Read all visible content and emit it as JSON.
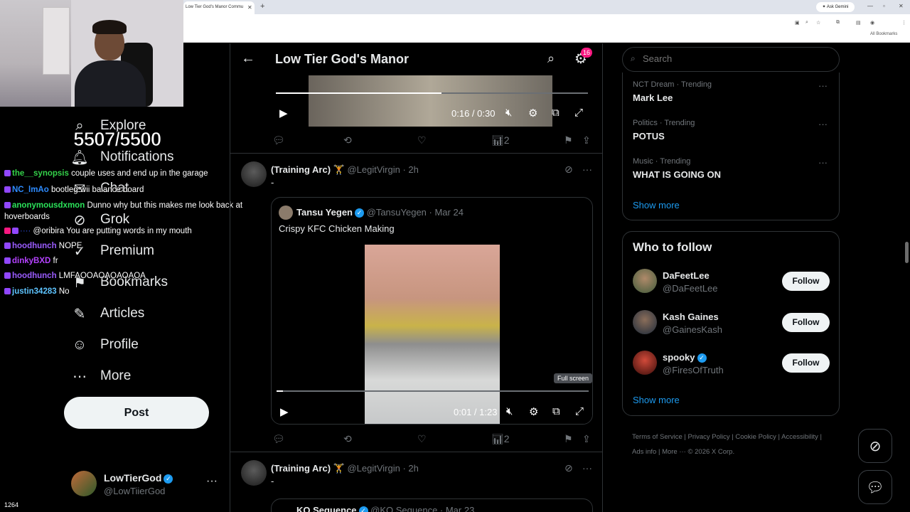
{
  "browser": {
    "tab_title": "Low Tier God's Manor Commu",
    "tab_close": "✕",
    "new_tab": "+",
    "ask_gemini": "✦ Ask Gemini",
    "bookmarks": "All Bookmarks"
  },
  "stream": {
    "sub_counter": "5507/5500",
    "viewer_count": "1264",
    "chat": [
      {
        "user": "the__synopsis",
        "color": "#34d24a",
        "msg": "couple uses and end up in the garage"
      },
      {
        "user": "NC_lmAo",
        "color": "#2e8cff",
        "msg": "bootleg wii balance board"
      },
      {
        "user": "anonymousdxmon",
        "color": "#2be35a",
        "msg": "Dunno why but this makes me look back at"
      },
      {
        "user": "",
        "color": "#fff",
        "msg": "hoverboards"
      },
      {
        "user": "",
        "color": "#2b4bd9",
        "msg": "@oribira You are putting words in my mouth"
      },
      {
        "user": "hoodhunch",
        "color": "#9b5cff",
        "msg": "NOPE"
      },
      {
        "user": "dinkyBXD",
        "color": "#b542ff",
        "msg": "fr"
      },
      {
        "user": "hoodhunch",
        "color": "#9b5cff",
        "msg": "LMFAOOAOAOAOAOA"
      },
      {
        "user": "justin34283",
        "color": "#5ec4ff",
        "msg": "No"
      }
    ]
  },
  "nav": {
    "items": [
      {
        "label": "Explore",
        "icon": "⌕"
      },
      {
        "label": "Notifications",
        "icon": "🔔︎"
      },
      {
        "label": "Chat",
        "icon": "✉"
      },
      {
        "label": "Grok",
        "icon": "⊘"
      },
      {
        "label": "Premium",
        "icon": "✓"
      },
      {
        "label": "Bookmarks",
        "icon": "⚑"
      },
      {
        "label": "Articles",
        "icon": "✎"
      },
      {
        "label": "Profile",
        "icon": "☺"
      },
      {
        "label": "More",
        "icon": "⋯"
      }
    ],
    "post_label": "Post"
  },
  "account": {
    "name": "LowTierGod",
    "handle": "@LowTiierGod",
    "more": "···"
  },
  "header": {
    "back": "←",
    "title": "Low Tier God's Manor",
    "notif_count": "16"
  },
  "video1": {
    "time": "0:16 / 0:30",
    "progress": 0.53
  },
  "action_row": {
    "views": "2"
  },
  "tweet1": {
    "name": "(Training Arc) 🏋",
    "handle": "@LegitVirgin · 2h",
    "text": "-",
    "quote": {
      "name": "Tansu Yegen",
      "handle": "@TansuYegen · Mar 24",
      "text": "Crispy KFC Chicken Making"
    },
    "video_time": "0:01 / 1:23",
    "progress": 0.02,
    "tooltip": "Full screen",
    "views": "2"
  },
  "tweet2": {
    "name": "(Training Arc) 🏋",
    "handle": "@LegitVirgin · 2h",
    "text": "-",
    "quote_name": "KO Sequence",
    "quote_handle": "@KO Sequence · Mar 23"
  },
  "right": {
    "search_placeholder": "Search",
    "trends": [
      {
        "meta": "NCT Dream · Trending",
        "name": "Mark Lee"
      },
      {
        "meta": "Politics · Trending",
        "name": "POTUS"
      },
      {
        "meta": "Music · Trending",
        "name": "WHAT IS GOING ON"
      }
    ],
    "show_more": "Show more",
    "who_to_follow": "Who to follow",
    "follow": [
      {
        "name": "DaFeetLee",
        "handle": "@DaFeetLee",
        "verified": false
      },
      {
        "name": "Kash Gaines",
        "handle": "@GainesKash",
        "verified": false
      },
      {
        "name": "spooky",
        "handle": "@FiresOfTruth",
        "verified": true
      }
    ],
    "follow_label": "Follow",
    "footer": "Terms of Service  |  Privacy Policy  |  Cookie Policy  |  Accessibility  |  Ads info  |  More ···  © 2026 X Corp."
  }
}
